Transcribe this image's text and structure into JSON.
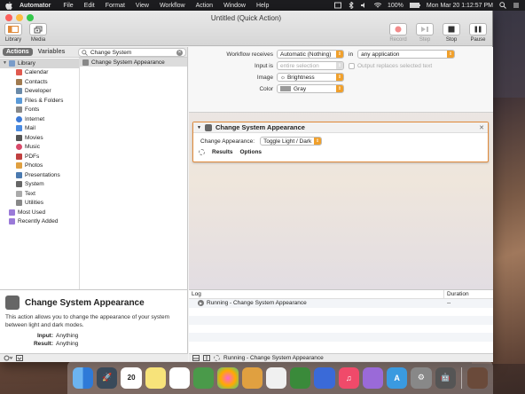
{
  "menubar": {
    "app_name": "Automator",
    "menus": [
      "File",
      "Edit",
      "Format",
      "View",
      "Workflow",
      "Action",
      "Window",
      "Help"
    ],
    "battery": "100%",
    "clock": "Mon Mar 20  1:12:57 PM"
  },
  "window": {
    "title": "Untitled (Quick Action)"
  },
  "toolbar": {
    "library_label": "Library",
    "media_label": "Media",
    "record_label": "Record",
    "step_label": "Step",
    "stop_label": "Stop",
    "pause_label": "Pause"
  },
  "library": {
    "tab_actions": "Actions",
    "tab_variables": "Variables",
    "search_value": "Change System",
    "tree": [
      {
        "label": "Library",
        "color": "#7a9cc9"
      },
      {
        "label": "Calendar",
        "color": "#e05a4f"
      },
      {
        "label": "Contacts",
        "color": "#a07a4f"
      },
      {
        "label": "Developer",
        "color": "#6a8aa8"
      },
      {
        "label": "Files & Folders",
        "color": "#5a9ad8"
      },
      {
        "label": "Fonts",
        "color": "#888888"
      },
      {
        "label": "Internet",
        "color": "#3c7ad8"
      },
      {
        "label": "Mail",
        "color": "#4a8ae0"
      },
      {
        "label": "Movies",
        "color": "#555555"
      },
      {
        "label": "Music",
        "color": "#d84a6a"
      },
      {
        "label": "PDFs",
        "color": "#c04040"
      },
      {
        "label": "Photos",
        "color": "#e0a040"
      },
      {
        "label": "Presentations",
        "color": "#4a7ab0"
      },
      {
        "label": "System",
        "color": "#666666"
      },
      {
        "label": "Text",
        "color": "#aaaaaa"
      },
      {
        "label": "Utilities",
        "color": "#888888"
      },
      {
        "label": "Most Used",
        "color": "#9a7ad8"
      },
      {
        "label": "Recently Added",
        "color": "#9a7ad8"
      }
    ],
    "result": "Change System Appearance"
  },
  "description": {
    "title": "Change System Appearance",
    "text": "This action allows you to change the appearance of your system between light and dark modes.",
    "input_key": "Input:",
    "input_val": "Anything",
    "result_key": "Result:",
    "result_val": "Anything"
  },
  "workflow": {
    "receives_label": "Workflow receives",
    "receives_value": "Automatic (Nothing)",
    "in_label": "in",
    "in_value": "any application",
    "input_is_label": "Input is",
    "input_is_value": "entire selection",
    "output_replaces_label": "Output replaces selected text",
    "image_label": "Image",
    "image_value": "Brightness",
    "color_label": "Color",
    "color_value": "Gray"
  },
  "action": {
    "title": "Change System Appearance",
    "field_label": "Change Appearance:",
    "field_value": "Toggle Light / Dark",
    "results_label": "Results",
    "options_label": "Options"
  },
  "log": {
    "col_log": "Log",
    "col_duration": "Duration",
    "rows": [
      {
        "text": "Running - Change System Appearance",
        "duration": "--"
      }
    ],
    "status": "Running - Change System Appearance"
  }
}
